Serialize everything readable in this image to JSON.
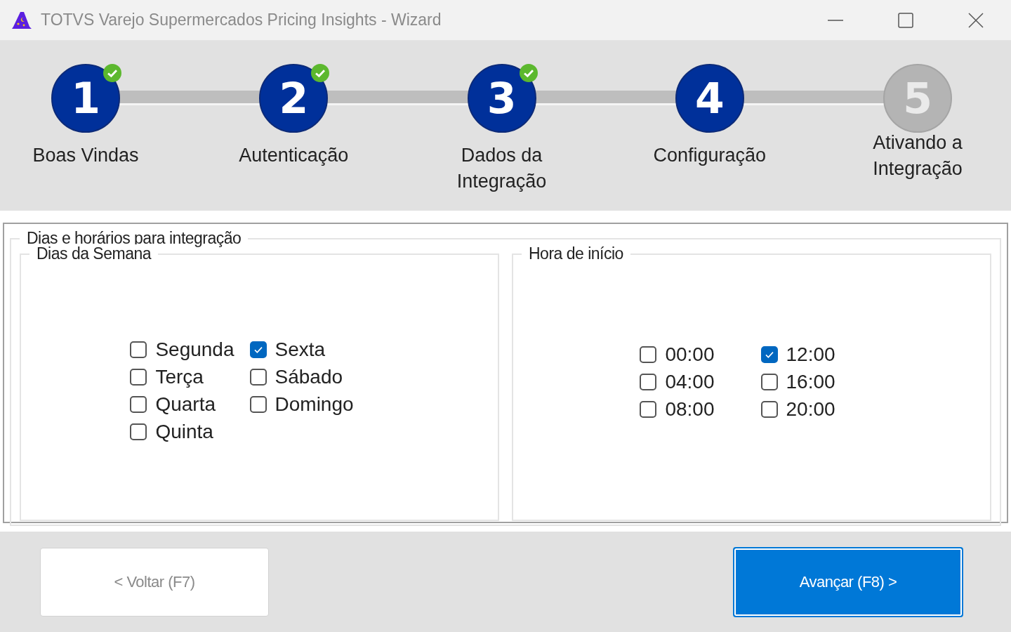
{
  "window": {
    "title": "TOTVS Varejo Supermercados Pricing Insights - Wizard"
  },
  "steps": [
    {
      "number": "1",
      "label": "Boas Vindas",
      "completed": true,
      "reached": true
    },
    {
      "number": "2",
      "label": "Autenticação",
      "completed": true,
      "reached": true
    },
    {
      "number": "3",
      "label": "Dados da Integração",
      "completed": true,
      "reached": true
    },
    {
      "number": "4",
      "label": "Configuração",
      "completed": false,
      "reached": true
    },
    {
      "number": "5",
      "label": "Ativando a Integração",
      "completed": false,
      "reached": false
    }
  ],
  "schedule": {
    "title": "Dias e horários para integração",
    "days": {
      "title": "Dias da Semana",
      "items": [
        {
          "label": "Segunda",
          "checked": false
        },
        {
          "label": "Terça",
          "checked": false
        },
        {
          "label": "Quarta",
          "checked": false
        },
        {
          "label": "Quinta",
          "checked": false
        },
        {
          "label": "Sexta",
          "checked": true
        },
        {
          "label": "Sábado",
          "checked": false
        },
        {
          "label": "Domingo",
          "checked": false
        }
      ]
    },
    "hours": {
      "title": "Hora de início",
      "items": [
        {
          "label": "00:00",
          "checked": false
        },
        {
          "label": "04:00",
          "checked": false
        },
        {
          "label": "08:00",
          "checked": false
        },
        {
          "label": "12:00",
          "checked": true
        },
        {
          "label": "16:00",
          "checked": false
        },
        {
          "label": "20:00",
          "checked": false
        }
      ]
    }
  },
  "buttons": [
    {
      "label": "< Voltar (F7)",
      "kind": "back",
      "disabled": true
    },
    {
      "label": "Avançar (F8) >",
      "kind": "next",
      "disabled": false
    }
  ]
}
